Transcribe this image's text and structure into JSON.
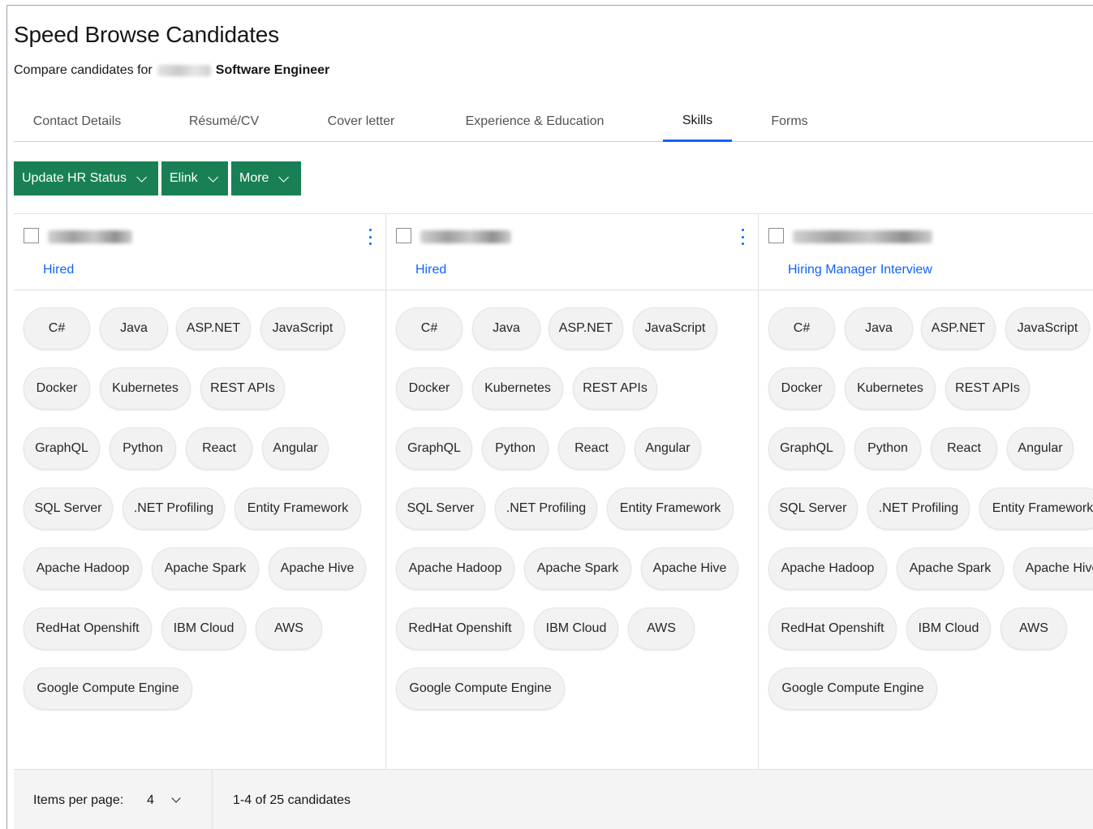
{
  "header": {
    "title": "Speed Browse Candidates",
    "subtitle_prefix": "Compare candidates for",
    "role": "Software Engineer"
  },
  "tabs": [
    {
      "label": "Contact Details",
      "active": false
    },
    {
      "label": "Résumé/CV",
      "active": false
    },
    {
      "label": "Cover letter",
      "active": false
    },
    {
      "label": "Experience & Education",
      "active": false
    },
    {
      "label": "Skills",
      "active": true
    },
    {
      "label": "Forms",
      "active": false
    }
  ],
  "toolbar": {
    "update_hr_status": "Update HR Status",
    "elink": "Elink",
    "more": "More"
  },
  "candidates": [
    {
      "status": "Hired"
    },
    {
      "status": "Hired"
    },
    {
      "status": "Hiring Manager Interview"
    }
  ],
  "skills": [
    "C#",
    "Java",
    "ASP.NET",
    "JavaScript",
    "Docker",
    "Kubernetes",
    "REST APIs",
    "GraphQL",
    "Python",
    "React",
    "Angular",
    "SQL Server",
    ".NET Profiling",
    "Entity Framework",
    "Apache Hadoop",
    "Apache Spark",
    "Apache Hive",
    "RedHat Openshift",
    "IBM Cloud",
    "AWS",
    "Google Compute Engine"
  ],
  "footer": {
    "items_per_page_label": "Items per page:",
    "items_per_page_value": "4",
    "range_text": "1-4 of 25 candidates"
  },
  "colors": {
    "primary_button": "#198055",
    "link": "#0f62fe",
    "chip_bg": "#f2f2f2"
  }
}
